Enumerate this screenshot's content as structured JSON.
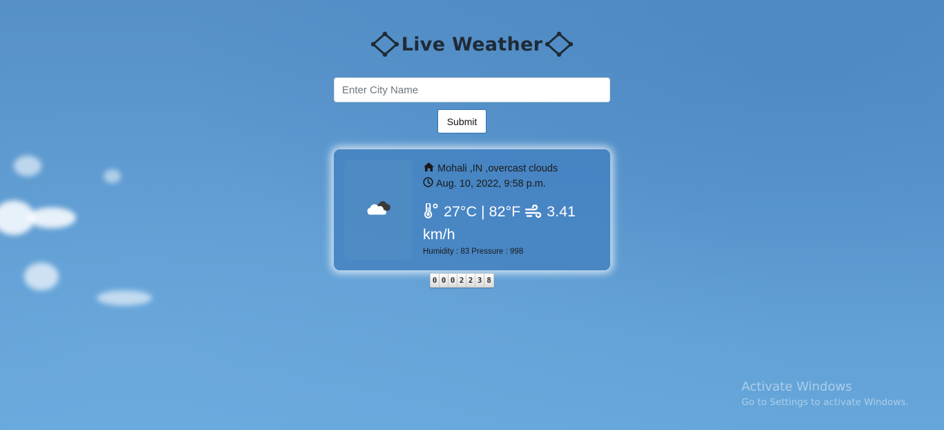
{
  "header": {
    "title": "Live Weather",
    "decoration_icon": "diamond-frame-icon"
  },
  "search": {
    "value": "",
    "placeholder": "Enter City Name",
    "submit_label": "Submit"
  },
  "weather": {
    "condition_icon": "cloudy-icon",
    "location_icon": "home-icon",
    "location": "Mohali ,IN ,overcast clouds",
    "time_icon": "clock-icon",
    "datetime": "Aug. 10, 2022, 9:58 p.m.",
    "temperature_icon": "thermometer-icon",
    "temperature_text": "27°C | 82°F",
    "wind_icon": "wind-icon",
    "wind_text": "3.41 km/h",
    "stats": "Humidity : 83 Pressure : 998"
  },
  "visitor_counter": {
    "digits": [
      "0",
      "0",
      "0",
      "2",
      "2",
      "3",
      "8"
    ]
  },
  "os_watermark": {
    "title": "Activate Windows",
    "subtitle": "Go to Settings to activate Windows."
  },
  "colors": {
    "sky_background": "#5c99cf",
    "card_background": "#4280c0",
    "temperature_text": "#ffffff",
    "title_text": "#1f2a36"
  }
}
